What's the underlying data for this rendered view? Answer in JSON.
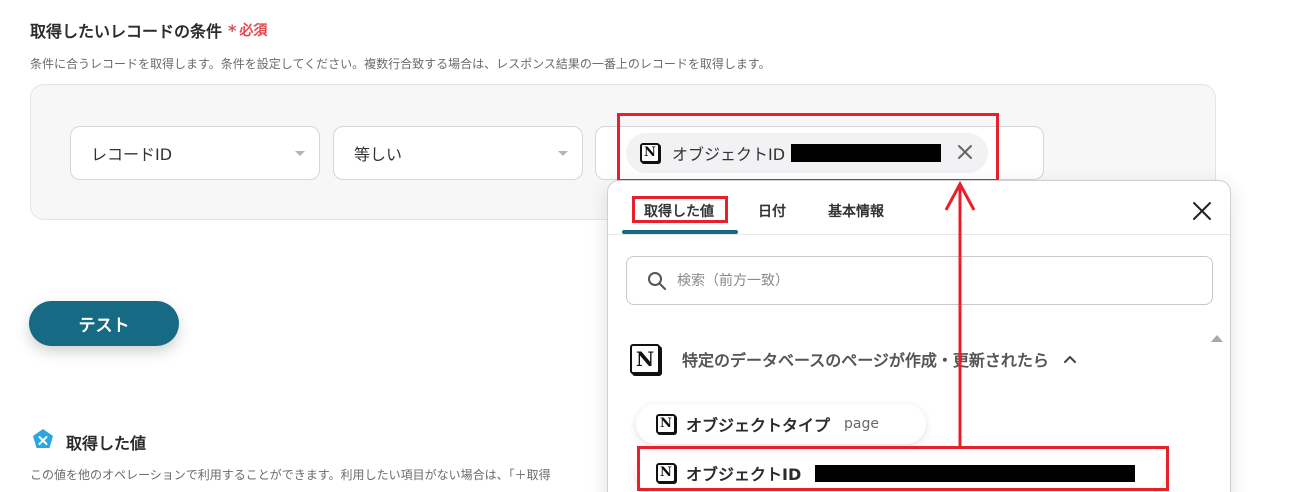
{
  "section": {
    "title": "取得したいレコードの条件",
    "required_star": "*",
    "required_label": "必須",
    "description": "条件に合うレコードを取得します。条件を設定してください。複数行合致する場合は、レスポンス結果の一番上のレコードを取得します。"
  },
  "condition": {
    "field_select": "レコードID",
    "operator_select": "等しい",
    "value_chip": {
      "icon": "notion-icon",
      "label": "オブジェクトID"
    }
  },
  "test_button": {
    "label": "テスト"
  },
  "acquired": {
    "title": "取得した値",
    "description": "この値を他のオペレーションで利用することができます。利用したい項目がない場合は、「＋取得"
  },
  "dropdown": {
    "tabs": [
      {
        "label": "取得した値",
        "active": true
      },
      {
        "label": "日付",
        "active": false
      },
      {
        "label": "基本情報",
        "active": false
      }
    ],
    "search_placeholder": "検索（前方一致）",
    "group": {
      "icon": "notion-icon",
      "title": "特定のデータベースのページが作成・更新されたら"
    },
    "items": [
      {
        "icon": "notion-icon",
        "name": "オブジェクトタイプ",
        "value": "page"
      },
      {
        "icon": "notion-icon",
        "name": "オブジェクトID"
      }
    ]
  },
  "colors": {
    "accent": "#176a83",
    "required": "#e5484d",
    "highlight": "#e8202a"
  }
}
